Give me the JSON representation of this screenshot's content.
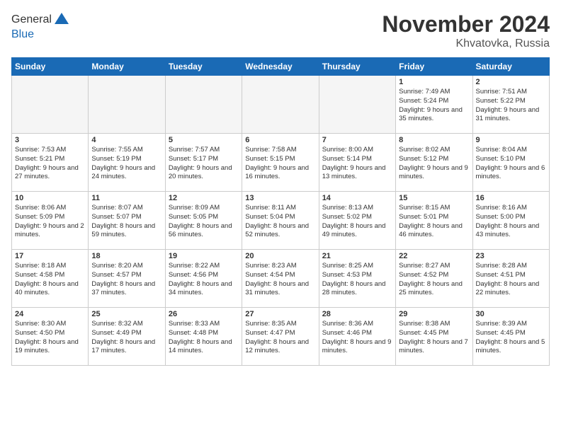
{
  "header": {
    "logo_general": "General",
    "logo_blue": "Blue",
    "month_title": "November 2024",
    "location": "Khvatovka, Russia"
  },
  "weekdays": [
    "Sunday",
    "Monday",
    "Tuesday",
    "Wednesday",
    "Thursday",
    "Friday",
    "Saturday"
  ],
  "weeks": [
    [
      {
        "day": "",
        "info": "",
        "empty": true
      },
      {
        "day": "",
        "info": "",
        "empty": true
      },
      {
        "day": "",
        "info": "",
        "empty": true
      },
      {
        "day": "",
        "info": "",
        "empty": true
      },
      {
        "day": "",
        "info": "",
        "empty": true
      },
      {
        "day": "1",
        "info": "Sunrise: 7:49 AM\nSunset: 5:24 PM\nDaylight: 9 hours and 35 minutes.",
        "empty": false
      },
      {
        "day": "2",
        "info": "Sunrise: 7:51 AM\nSunset: 5:22 PM\nDaylight: 9 hours and 31 minutes.",
        "empty": false
      }
    ],
    [
      {
        "day": "3",
        "info": "Sunrise: 7:53 AM\nSunset: 5:21 PM\nDaylight: 9 hours and 27 minutes.",
        "empty": false
      },
      {
        "day": "4",
        "info": "Sunrise: 7:55 AM\nSunset: 5:19 PM\nDaylight: 9 hours and 24 minutes.",
        "empty": false
      },
      {
        "day": "5",
        "info": "Sunrise: 7:57 AM\nSunset: 5:17 PM\nDaylight: 9 hours and 20 minutes.",
        "empty": false
      },
      {
        "day": "6",
        "info": "Sunrise: 7:58 AM\nSunset: 5:15 PM\nDaylight: 9 hours and 16 minutes.",
        "empty": false
      },
      {
        "day": "7",
        "info": "Sunrise: 8:00 AM\nSunset: 5:14 PM\nDaylight: 9 hours and 13 minutes.",
        "empty": false
      },
      {
        "day": "8",
        "info": "Sunrise: 8:02 AM\nSunset: 5:12 PM\nDaylight: 9 hours and 9 minutes.",
        "empty": false
      },
      {
        "day": "9",
        "info": "Sunrise: 8:04 AM\nSunset: 5:10 PM\nDaylight: 9 hours and 6 minutes.",
        "empty": false
      }
    ],
    [
      {
        "day": "10",
        "info": "Sunrise: 8:06 AM\nSunset: 5:09 PM\nDaylight: 9 hours and 2 minutes.",
        "empty": false
      },
      {
        "day": "11",
        "info": "Sunrise: 8:07 AM\nSunset: 5:07 PM\nDaylight: 8 hours and 59 minutes.",
        "empty": false
      },
      {
        "day": "12",
        "info": "Sunrise: 8:09 AM\nSunset: 5:05 PM\nDaylight: 8 hours and 56 minutes.",
        "empty": false
      },
      {
        "day": "13",
        "info": "Sunrise: 8:11 AM\nSunset: 5:04 PM\nDaylight: 8 hours and 52 minutes.",
        "empty": false
      },
      {
        "day": "14",
        "info": "Sunrise: 8:13 AM\nSunset: 5:02 PM\nDaylight: 8 hours and 49 minutes.",
        "empty": false
      },
      {
        "day": "15",
        "info": "Sunrise: 8:15 AM\nSunset: 5:01 PM\nDaylight: 8 hours and 46 minutes.",
        "empty": false
      },
      {
        "day": "16",
        "info": "Sunrise: 8:16 AM\nSunset: 5:00 PM\nDaylight: 8 hours and 43 minutes.",
        "empty": false
      }
    ],
    [
      {
        "day": "17",
        "info": "Sunrise: 8:18 AM\nSunset: 4:58 PM\nDaylight: 8 hours and 40 minutes.",
        "empty": false
      },
      {
        "day": "18",
        "info": "Sunrise: 8:20 AM\nSunset: 4:57 PM\nDaylight: 8 hours and 37 minutes.",
        "empty": false
      },
      {
        "day": "19",
        "info": "Sunrise: 8:22 AM\nSunset: 4:56 PM\nDaylight: 8 hours and 34 minutes.",
        "empty": false
      },
      {
        "day": "20",
        "info": "Sunrise: 8:23 AM\nSunset: 4:54 PM\nDaylight: 8 hours and 31 minutes.",
        "empty": false
      },
      {
        "day": "21",
        "info": "Sunrise: 8:25 AM\nSunset: 4:53 PM\nDaylight: 8 hours and 28 minutes.",
        "empty": false
      },
      {
        "day": "22",
        "info": "Sunrise: 8:27 AM\nSunset: 4:52 PM\nDaylight: 8 hours and 25 minutes.",
        "empty": false
      },
      {
        "day": "23",
        "info": "Sunrise: 8:28 AM\nSunset: 4:51 PM\nDaylight: 8 hours and 22 minutes.",
        "empty": false
      }
    ],
    [
      {
        "day": "24",
        "info": "Sunrise: 8:30 AM\nSunset: 4:50 PM\nDaylight: 8 hours and 19 minutes.",
        "empty": false
      },
      {
        "day": "25",
        "info": "Sunrise: 8:32 AM\nSunset: 4:49 PM\nDaylight: 8 hours and 17 minutes.",
        "empty": false
      },
      {
        "day": "26",
        "info": "Sunrise: 8:33 AM\nSunset: 4:48 PM\nDaylight: 8 hours and 14 minutes.",
        "empty": false
      },
      {
        "day": "27",
        "info": "Sunrise: 8:35 AM\nSunset: 4:47 PM\nDaylight: 8 hours and 12 minutes.",
        "empty": false
      },
      {
        "day": "28",
        "info": "Sunrise: 8:36 AM\nSunset: 4:46 PM\nDaylight: 8 hours and 9 minutes.",
        "empty": false
      },
      {
        "day": "29",
        "info": "Sunrise: 8:38 AM\nSunset: 4:45 PM\nDaylight: 8 hours and 7 minutes.",
        "empty": false
      },
      {
        "day": "30",
        "info": "Sunrise: 8:39 AM\nSunset: 4:45 PM\nDaylight: 8 hours and 5 minutes.",
        "empty": false
      }
    ]
  ]
}
